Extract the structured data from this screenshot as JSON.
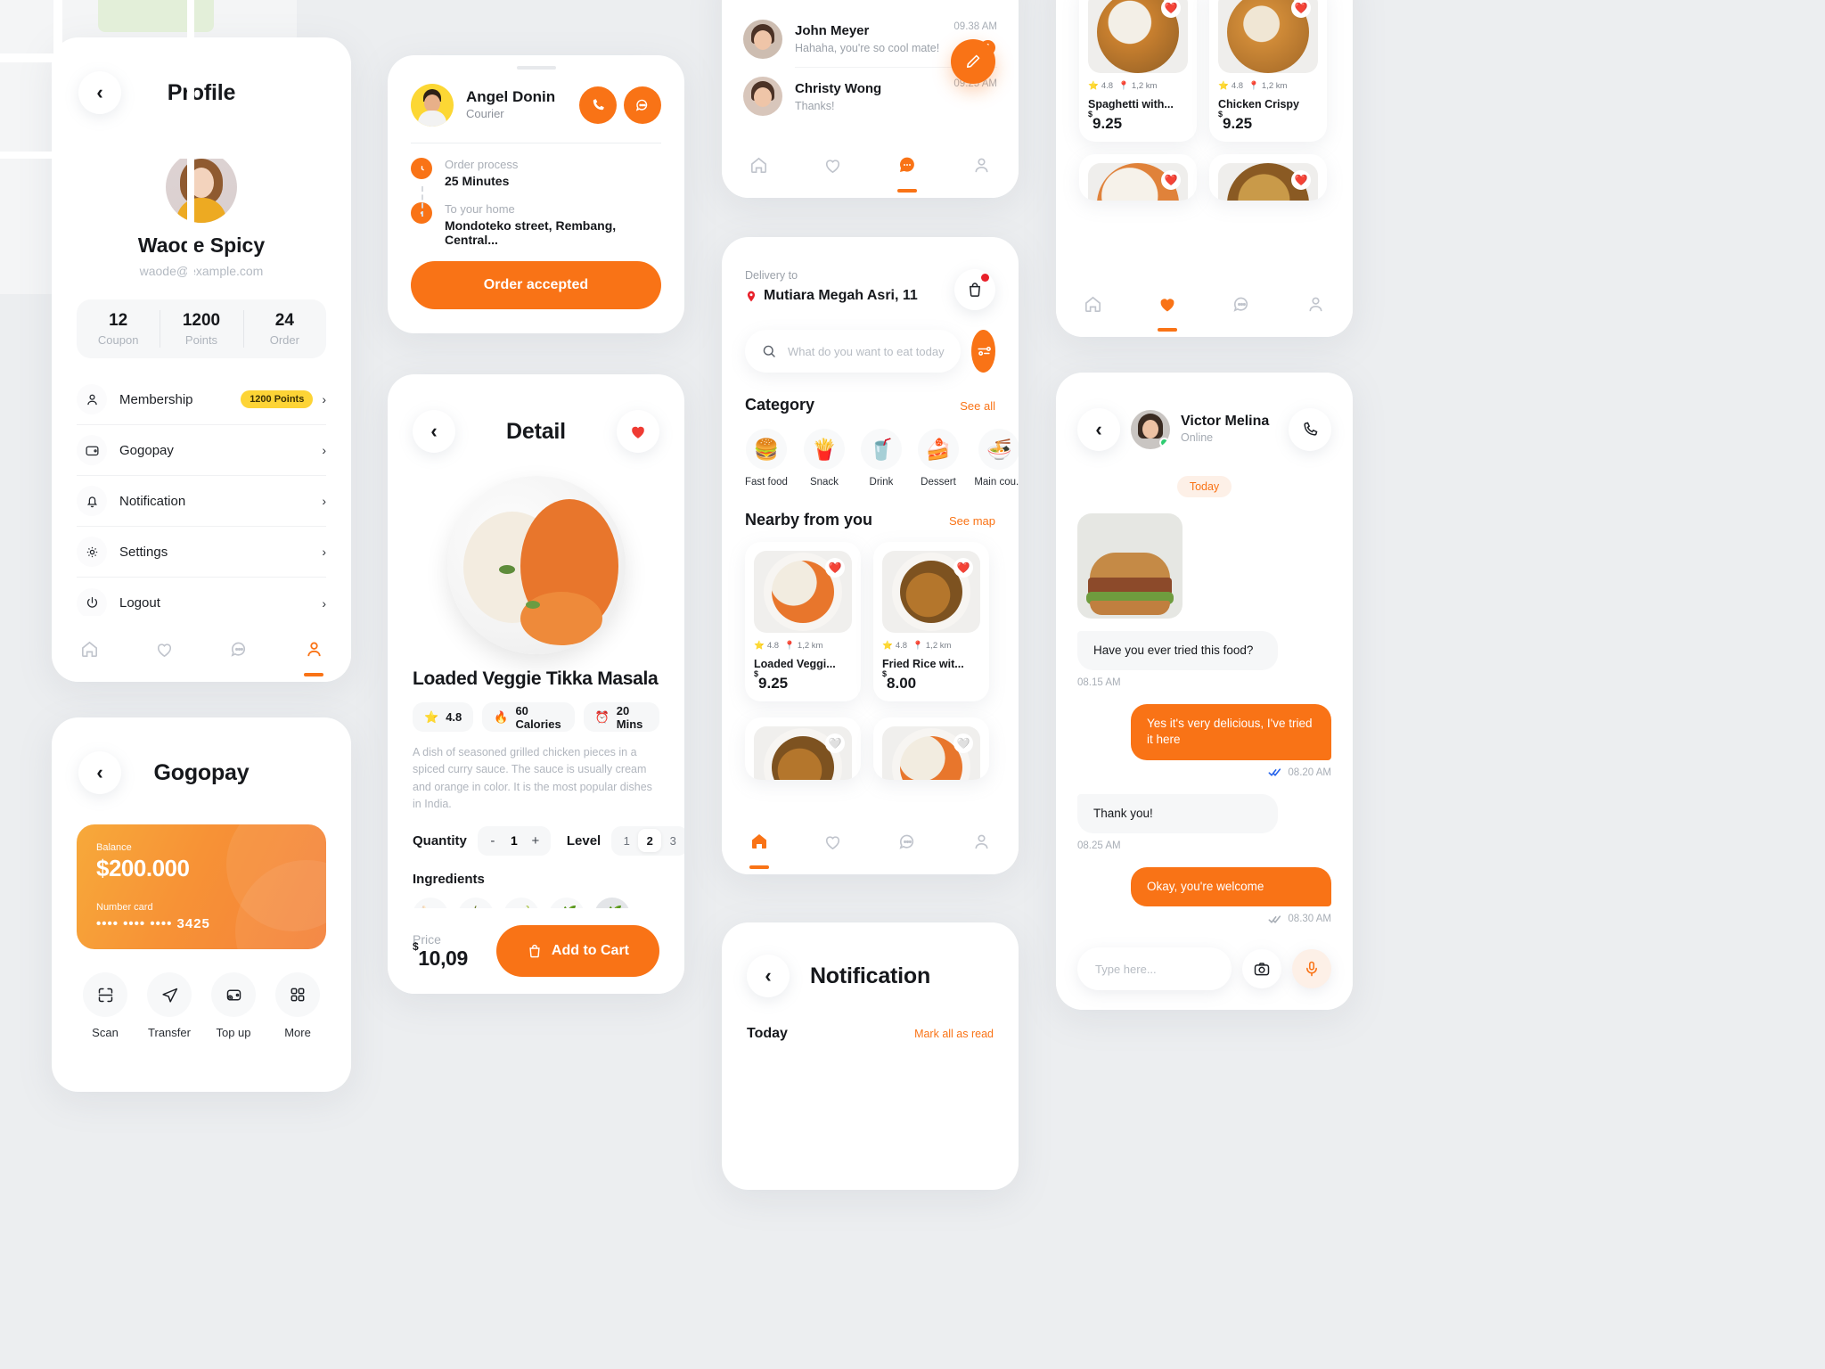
{
  "profile": {
    "title": "Profile",
    "back_icon": "chevron-left-icon",
    "name": "Waode Spicy",
    "email": "waode@example.com",
    "stats": [
      {
        "value": "12",
        "label": "Coupon"
      },
      {
        "value": "1200",
        "label": "Points"
      },
      {
        "value": "24",
        "label": "Order"
      }
    ],
    "menu": [
      {
        "icon": "user-icon",
        "label": "Membership",
        "badge": "1200 Points"
      },
      {
        "icon": "wallet-icon",
        "label": "Gogopay",
        "badge": ""
      },
      {
        "icon": "bell-icon",
        "label": "Notification",
        "badge": ""
      },
      {
        "icon": "gear-icon",
        "label": "Settings",
        "badge": ""
      },
      {
        "icon": "power-icon",
        "label": "Logout",
        "badge": ""
      }
    ],
    "tabs": [
      {
        "icon": "home-icon",
        "active": false
      },
      {
        "icon": "heart-icon",
        "active": false
      },
      {
        "icon": "chat-icon",
        "active": false
      },
      {
        "icon": "user-icon",
        "active": true
      }
    ]
  },
  "gogopay": {
    "title": "Gogopay",
    "balance_label": "Balance",
    "balance_value": "$200.000",
    "card_label": "Number card",
    "card_number": "•••• •••• •••• 3425",
    "actions": [
      {
        "icon": "scan-icon",
        "label": "Scan"
      },
      {
        "icon": "send-icon",
        "label": "Transfer"
      },
      {
        "icon": "topup-wallet-icon",
        "label": "Top up"
      },
      {
        "icon": "grid-more-icon",
        "label": "More"
      }
    ]
  },
  "courier": {
    "name": "Angel Donin",
    "role": "Courier",
    "call_icon": "phone-icon",
    "chat_icon": "chat-icon",
    "steps": [
      {
        "icon": "clock-icon",
        "label": "Order process",
        "value": "25 Minutes"
      },
      {
        "icon": "pin-icon",
        "label": "To your home",
        "value": "Mondoteko street, Rembang, Central..."
      }
    ],
    "cta": "Order accepted"
  },
  "detail": {
    "title": "Detail",
    "back_icon": "chevron-left-icon",
    "favorite_icon": "heart-filled-icon",
    "food_name": "Loaded Veggie Tikka Masala",
    "chips": [
      {
        "icon": "star-icon",
        "text": "4.8"
      },
      {
        "icon": "fire-icon",
        "text": "60 Calories"
      },
      {
        "icon": "alarm-icon",
        "text": "20 Mins"
      }
    ],
    "description": "A dish of seasoned grilled chicken pieces in a spiced curry sauce. The sauce is usually cream and orange in color.  It is the most popular dishes in India.",
    "quantity_label": "Quantity",
    "quantity_value": "1",
    "quantity_minus": "-",
    "quantity_plus": "+",
    "level_label": "Level",
    "levels": [
      "1",
      "2",
      "3"
    ],
    "level_selected": "2",
    "ingredients_label": "Ingredients",
    "ingredients": [
      "🍗",
      "🍅",
      "🌶️",
      "🌿",
      "🌿"
    ],
    "price_label": "Price",
    "price_currency": "$",
    "price_value": "10,09",
    "cart_button": "Add to Cart",
    "cart_icon": "bag-icon"
  },
  "messages": {
    "items": [
      {
        "name": "John Meyer",
        "preview": "Hahaha, you're so cool mate!",
        "time": "09.38 AM",
        "unread": "1"
      },
      {
        "name": "Christy Wong",
        "preview": "Thanks!",
        "time": "09.25 AM",
        "unread": ""
      }
    ],
    "compose_icon": "pencil-icon",
    "tabs": [
      {
        "icon": "home-icon",
        "active": false
      },
      {
        "icon": "heart-icon",
        "active": false
      },
      {
        "icon": "chat-icon",
        "active": true
      },
      {
        "icon": "user-icon",
        "active": false
      }
    ]
  },
  "home": {
    "delivery_label": "Delivery to",
    "address": "Mutiara Megah Asri, 11",
    "pin_icon": "pin-icon",
    "bag_icon": "bag-icon",
    "search_placeholder": "What do you want to eat today?",
    "search_value": "",
    "search_icon": "search-icon",
    "filter_icon": "sliders-icon",
    "category_title": "Category",
    "category_see_all": "See all",
    "categories": [
      {
        "emoji": "🍔",
        "label": "Fast food"
      },
      {
        "emoji": "🍟",
        "label": "Snack"
      },
      {
        "emoji": "🥤",
        "label": "Drink"
      },
      {
        "emoji": "🍰",
        "label": "Dessert"
      },
      {
        "emoji": "🍜",
        "label": "Main cou..."
      }
    ],
    "nearby_title": "Nearby from you",
    "nearby_see_map": "See map",
    "nearby": [
      {
        "name": "Loaded Veggi...",
        "rating": "4.8",
        "distance": "1,2 km",
        "currency": "$",
        "price": "9.25",
        "liked": true
      },
      {
        "name": "Fried Rice wit...",
        "rating": "4.8",
        "distance": "1,2 km",
        "currency": "$",
        "price": "8.00",
        "liked": true
      }
    ],
    "tabs": [
      {
        "icon": "home-icon",
        "active": true
      },
      {
        "icon": "heart-icon",
        "active": false
      },
      {
        "icon": "chat-icon",
        "active": false
      },
      {
        "icon": "user-icon",
        "active": false
      }
    ]
  },
  "notification": {
    "title": "Notification",
    "back_icon": "chevron-left-icon",
    "today_label": "Today",
    "mark_all": "Mark all as read"
  },
  "favorites": {
    "items": [
      {
        "name": "Spaghetti with...",
        "rating": "4.8",
        "distance": "1,2 km",
        "currency": "$",
        "price": "9.25"
      },
      {
        "name": "Chicken Crispy",
        "rating": "4.8",
        "distance": "1,2 km",
        "currency": "$",
        "price": "9.25"
      }
    ],
    "tabs": [
      {
        "icon": "home-icon",
        "active": false
      },
      {
        "icon": "heart-icon",
        "active": true
      },
      {
        "icon": "chat-icon",
        "active": false
      },
      {
        "icon": "user-icon",
        "active": false
      }
    ]
  },
  "chat": {
    "back_icon": "chevron-left-icon",
    "name": "Victor Melina",
    "status": "Online",
    "call_icon": "phone-icon",
    "date_divider": "Today",
    "messages": [
      {
        "from": "them",
        "type": "image",
        "text": ""
      },
      {
        "from": "them",
        "type": "text",
        "text": "Have you ever tried this food?",
        "time": "08.15 AM"
      },
      {
        "from": "me",
        "type": "text",
        "text": "Yes it's very delicious, I've tried it here",
        "time": "08.20 AM",
        "read": true
      },
      {
        "from": "them",
        "type": "text",
        "text": "Thank you!",
        "time": "08.25 AM"
      },
      {
        "from": "me",
        "type": "text",
        "text": "Okay, you're welcome",
        "time": "08.30 AM",
        "read": false
      }
    ],
    "input_placeholder": "Type here...",
    "input_value": "",
    "camera_icon": "camera-icon",
    "mic_icon": "microphone-icon"
  },
  "colors": {
    "accent": "#f97316",
    "accent_soft": "#fdf0e7",
    "yellow": "#fdd436",
    "bg": "#eceef0",
    "text": "#16181c",
    "muted": "#a7adb6",
    "online": "#2ecc71",
    "badge_red": "#e8202a"
  }
}
